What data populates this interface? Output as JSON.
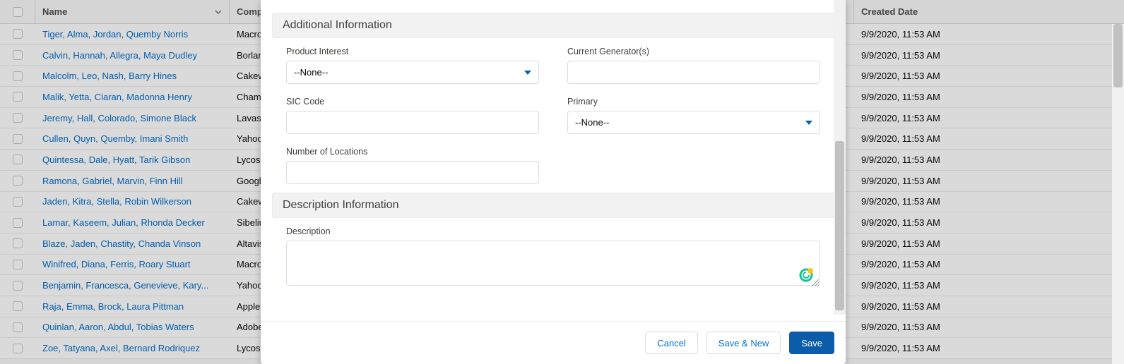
{
  "table": {
    "headers": {
      "name": "Name",
      "company": "Company",
      "created": "Created Date"
    },
    "rows": [
      {
        "name": "Tiger, Alma, Jordan, Quemby Norris",
        "company": "Macromedia",
        "created": "9/9/2020, 11:53 AM"
      },
      {
        "name": "Calvin, Hannah, Allegra, Maya Dudley",
        "company": "Borland",
        "created": "9/9/2020, 11:53 AM"
      },
      {
        "name": "Malcolm, Leo, Nash, Barry Hines",
        "company": "Cakewalk",
        "created": "9/9/2020, 11:53 AM"
      },
      {
        "name": "Malik, Yetta, Ciaran, Madonna Henry",
        "company": "Chami",
        "created": "9/9/2020, 11:53 AM"
      },
      {
        "name": "Jeremy, Hall, Colorado, Simone Black",
        "company": "Lavasoft",
        "created": "9/9/2020, 11:53 AM"
      },
      {
        "name": "Cullen, Quyn, Quemby, Imani Smith",
        "company": "Yahoo",
        "created": "9/9/2020, 11:53 AM"
      },
      {
        "name": "Quintessa, Dale, Hyatt, Tarik Gibson",
        "company": "Lycos",
        "created": "9/9/2020, 11:53 AM"
      },
      {
        "name": "Ramona, Gabriel, Marvin, Finn Hill",
        "company": "Google",
        "created": "9/9/2020, 11:53 AM"
      },
      {
        "name": "Jaden, Kitra, Stella, Robin Wilkerson",
        "company": "Cakewalk",
        "created": "9/9/2020, 11:53 AM"
      },
      {
        "name": "Lamar, Kaseem, Julian, Rhonda Decker",
        "company": "Sibelius",
        "created": "9/9/2020, 11:53 AM"
      },
      {
        "name": "Blaze, Jaden, Chastity, Chanda Vinson",
        "company": "Altavista",
        "created": "9/9/2020, 11:53 AM"
      },
      {
        "name": "Winifred, Diana, Ferris, Roary Stuart",
        "company": "Macromedia",
        "created": "9/9/2020, 11:53 AM"
      },
      {
        "name": "Benjamin, Francesca, Genevieve, Kary...",
        "company": "Yahoo",
        "created": "9/9/2020, 11:53 AM"
      },
      {
        "name": "Raja, Emma, Brock, Laura Pittman",
        "company": "Apple",
        "created": "9/9/2020, 11:53 AM"
      },
      {
        "name": "Quinlan, Aaron, Abdul, Tobias Waters",
        "company": "Adobe",
        "created": "9/9/2020, 11:53 AM"
      },
      {
        "name": "Zoe, Tatyana, Axel, Bernard Rodriquez",
        "company": "Lycos",
        "created": "9/9/2020, 11:53 AM"
      }
    ]
  },
  "modal": {
    "sections": {
      "additional": {
        "title": "Additional Information",
        "productInterest": {
          "label": "Product Interest",
          "value": "--None--"
        },
        "sicCode": {
          "label": "SIC Code",
          "value": ""
        },
        "numLocations": {
          "label": "Number of Locations",
          "value": ""
        },
        "currentGenerators": {
          "label": "Current Generator(s)",
          "value": ""
        },
        "primary": {
          "label": "Primary",
          "value": "--None--"
        }
      },
      "description": {
        "title": "Description Information",
        "description": {
          "label": "Description",
          "value": ""
        }
      }
    },
    "footer": {
      "cancel": "Cancel",
      "saveNew": "Save & New",
      "save": "Save"
    }
  }
}
